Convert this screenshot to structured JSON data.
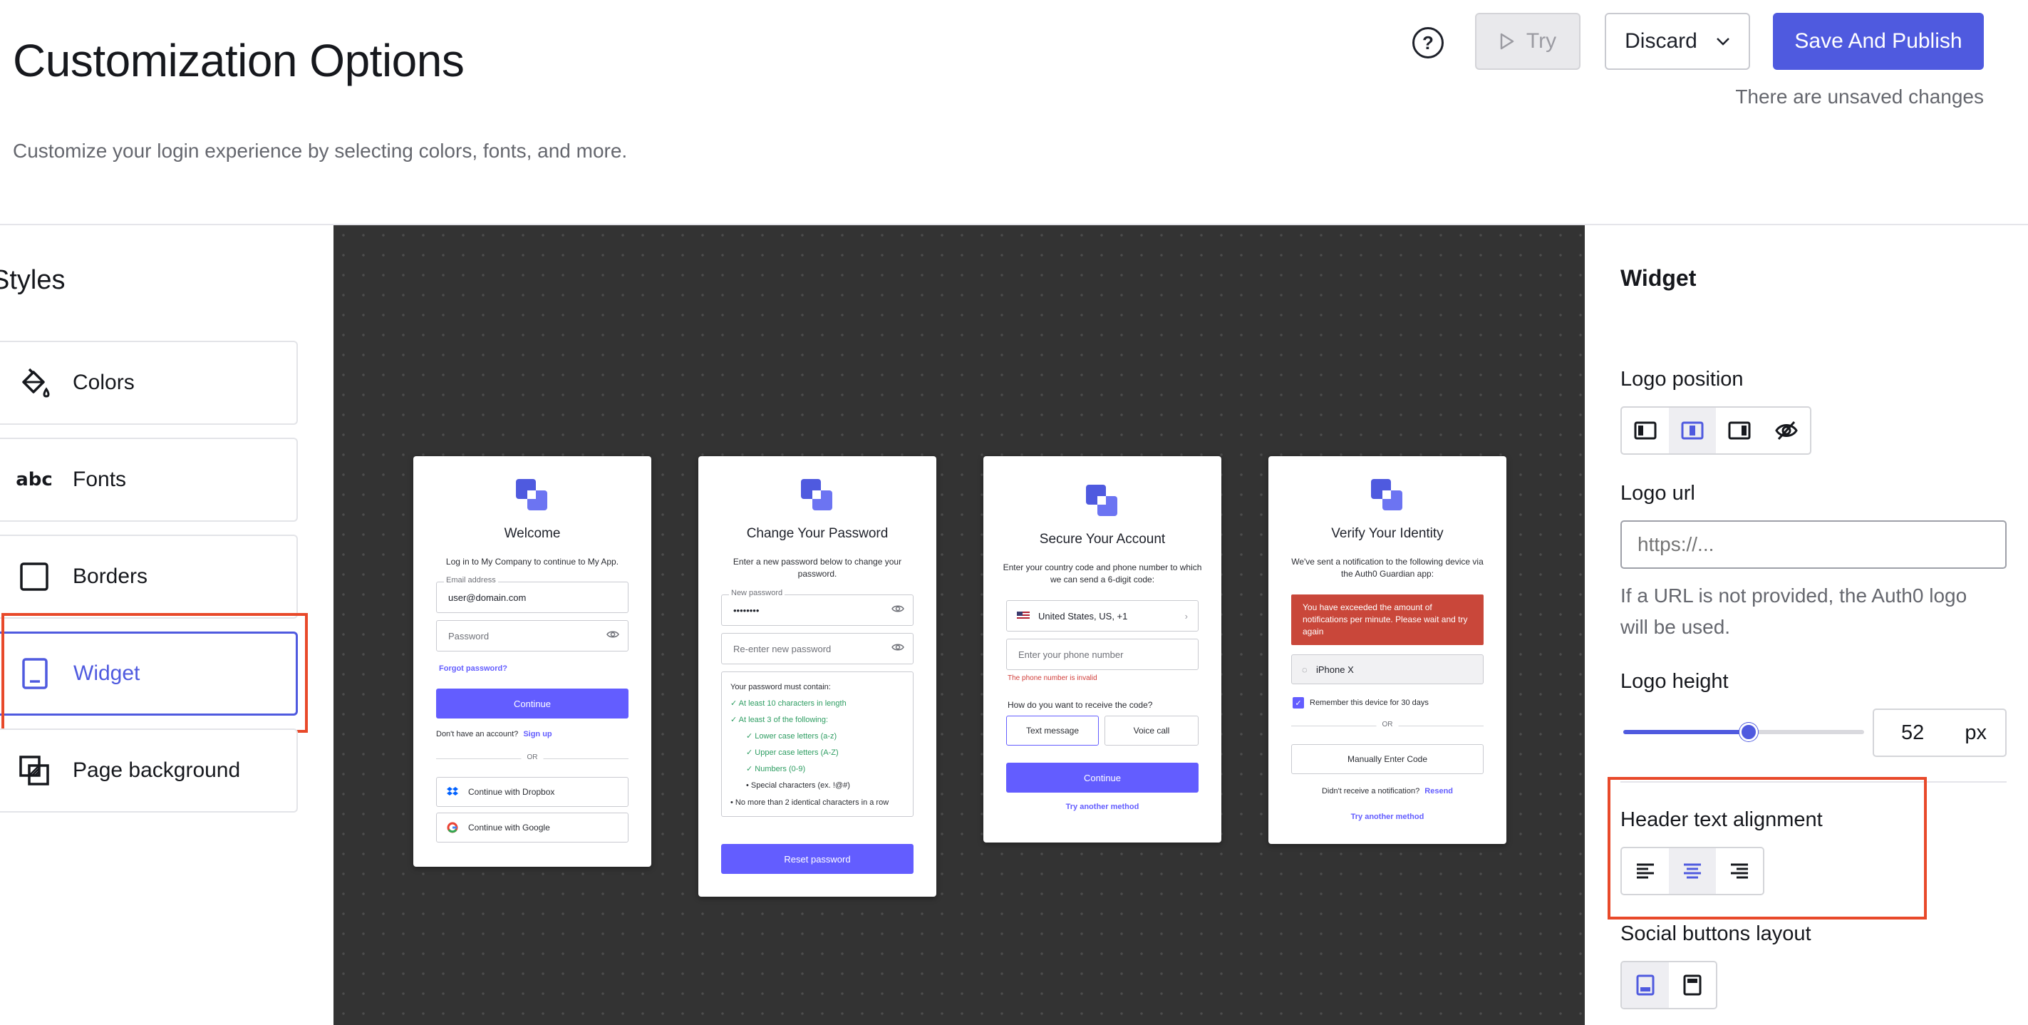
{
  "header": {
    "title": "Customization Options",
    "subtitle": "Customize your login experience by selecting colors, fonts, and more.",
    "help_icon": "question-circle-icon",
    "try_label": "Try",
    "discard_label": "Discard",
    "save_label": "Save And Publish",
    "unsaved_text": "There are unsaved changes"
  },
  "styles_panel": {
    "title": "Styles",
    "items": [
      {
        "label": "Colors",
        "icon": "paint-bucket-icon"
      },
      {
        "label": "Fonts",
        "icon": "abc-icon"
      },
      {
        "label": "Borders",
        "icon": "square-icon"
      },
      {
        "label": "Widget",
        "icon": "tablet-icon",
        "active": true
      },
      {
        "label": "Page background",
        "icon": "layers-icon"
      }
    ]
  },
  "previews": {
    "login": {
      "title": "Welcome",
      "text": "Log in to My Company to continue to My App.",
      "email_label": "Email address",
      "email_value": "user@domain.com",
      "password_placeholder": "Password",
      "forgot": "Forgot password?",
      "continue": "Continue",
      "no_account": "Don't have an account?",
      "signup": "Sign up",
      "or": "OR",
      "dropbox": "Continue with Dropbox",
      "google": "Continue with Google"
    },
    "change_password": {
      "title": "Change Your Password",
      "text": "Enter a new password below to change your password.",
      "new_label": "New password",
      "new_value": "••••••••",
      "reenter": "Re-enter new password",
      "must": "Your password must contain:",
      "r1": "At least 10 characters in length",
      "r2": "At least 3 of the following:",
      "r3": "Lower case letters (a-z)",
      "r4": "Upper case letters (A-Z)",
      "r5": "Numbers (0-9)",
      "r6": "Special characters (ex. !@#)",
      "r7": "No more than 2 identical characters in a row",
      "reset": "Reset password"
    },
    "secure": {
      "title": "Secure Your Account",
      "text": "Enter your country code and phone number to which we can send a 6-digit code:",
      "country": "United States, US, +1",
      "phone_placeholder": "Enter your phone number",
      "error": "The phone number is invalid",
      "question": "How do you want to receive the code?",
      "sms": "Text message",
      "voice": "Voice call",
      "continue": "Continue",
      "another": "Try another method"
    },
    "verify": {
      "title": "Verify Your Identity",
      "text": "We've sent a notification to the following device via the Auth0 Guardian app:",
      "error": "You have exceeded the amount of notifications per minute. Please wait and try again",
      "device": "iPhone X",
      "remember": "Remember this device for 30 days",
      "or": "OR",
      "manual": "Manually Enter Code",
      "not_received": "Didn't receive a notification?",
      "resend": "Resend",
      "another": "Try another method"
    }
  },
  "widget_panel": {
    "title": "Widget",
    "logo_position_label": "Logo position",
    "logo_position_selected": "center",
    "logo_url_label": "Logo url",
    "logo_url_placeholder": "https://...",
    "logo_url_help": "If a URL is not provided, the Auth0 logo will be used.",
    "logo_height_label": "Logo height",
    "logo_height_value": "52",
    "logo_height_unit": "px",
    "logo_height_slider_fraction": 0.52,
    "header_alignment_label": "Header text alignment",
    "header_alignment_selected": "center",
    "social_layout_label": "Social buttons layout",
    "social_layout_selected": "bottom"
  },
  "colors": {
    "accent": "#4f5adf",
    "preview_primary": "#635dff",
    "highlight": "#e8492a",
    "canvas_bg": "#333333"
  }
}
